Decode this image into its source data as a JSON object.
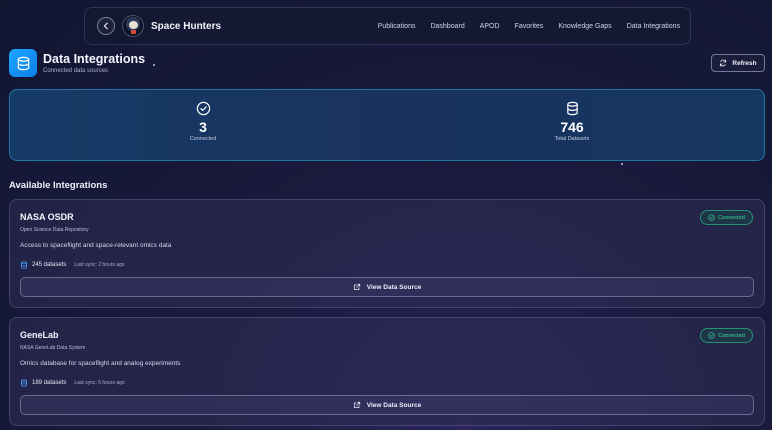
{
  "nav": {
    "brand": "Space Hunters",
    "links": [
      "Publications",
      "Dashboard",
      "APOD",
      "Favorites",
      "Knowledge Gaps",
      "Data Integrations"
    ]
  },
  "header": {
    "title": "Data Integrations",
    "subtitle": "Connected data sources",
    "refresh_label": "Refresh"
  },
  "stats": {
    "connected": {
      "value": "3",
      "label": "Connected"
    },
    "datasets": {
      "value": "746",
      "label": "Total Datasets"
    }
  },
  "section_title": "Available Integrations",
  "integrations": [
    {
      "name": "NASA OSDR",
      "org": "Open Science Data Repository",
      "description": "Access to spaceflight and space-relevant omics data",
      "datasets": "245 datasets",
      "last_sync": "Last sync: 2 hours ago",
      "status": "Connected",
      "button": "View Data Source"
    },
    {
      "name": "GeneLab",
      "org": "NASA GeneLab Data System",
      "description": "Omics database for spaceflight and analog experiments",
      "datasets": "189 datasets",
      "last_sync": "Last sync: 5 hours ago",
      "status": "Connected",
      "button": "View Data Source"
    }
  ],
  "colors": {
    "accent": "#1ea7ff",
    "connected": "#3fd89a",
    "stats_border": "#2896c8"
  },
  "icons": {
    "back": "chevron-left-icon",
    "header": "database-icon",
    "refresh": "refresh-icon",
    "connected": "check-circle-icon",
    "datasets": "database-icon",
    "view": "external-link-icon"
  }
}
